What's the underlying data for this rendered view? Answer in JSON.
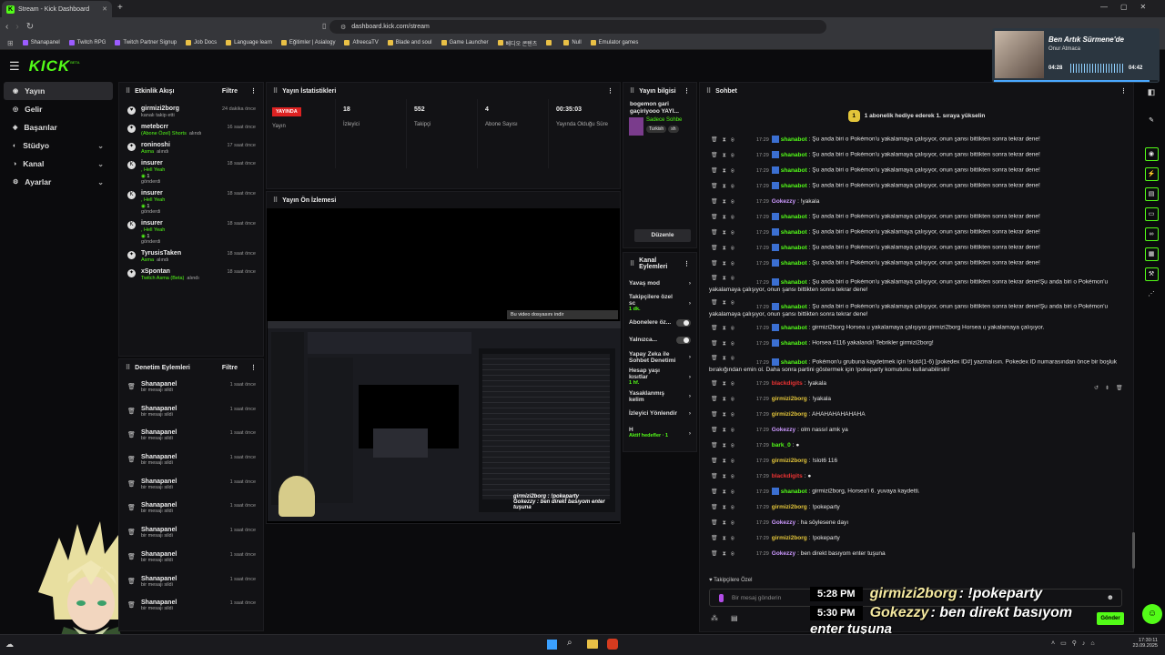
{
  "browser": {
    "tab_title": "Stream - Kick Dashboard",
    "url": "dashboard.kick.com/stream",
    "bookmarks": [
      "Shanapanel",
      "Twitch RPG",
      "Twitch Partner Signup",
      "Job Docs",
      "Language learn",
      "Eğitimler | Asialogy",
      "AfreecaTV",
      "Blade and soul",
      "Game Launcher",
      "베디오 콘텐츠",
      "",
      "Null",
      "Emulator games"
    ]
  },
  "app": {
    "logo": "KICK",
    "logo_sup": "BETA"
  },
  "nav": [
    {
      "label": "Yayın",
      "active": true
    },
    {
      "label": "Gelir"
    },
    {
      "label": "Başarılar"
    },
    {
      "label": "Stüdyo",
      "chev": true
    },
    {
      "label": "Kanal",
      "chev": true
    },
    {
      "label": "Ayarlar",
      "chev": true
    }
  ],
  "activity": {
    "title": "Etkinlik Akışı",
    "filter": "Filtre",
    "rows": [
      {
        "name": "girmizi2borg",
        "sub": "kanalı takip etti",
        "time": "24 dakika önce",
        "sub_gray": true
      },
      {
        "name": "metebcrr",
        "sub": "(Abone Özel) Shorts",
        "sub2": "alındı",
        "time": "16 saat önce"
      },
      {
        "name": "roninoshi",
        "sub": "Asma",
        "sub2": "alındı",
        "time": "17 saat önce"
      },
      {
        "name": "insurer",
        "sub": ", Hell Yeah",
        "sub3": "1",
        "sub4": "gönderdi",
        "time": "18 saat önce"
      },
      {
        "name": "insurer",
        "sub": ", Hell Yeah",
        "sub3": "1",
        "sub4": "gönderdi",
        "time": "18 saat önce"
      },
      {
        "name": "insurer",
        "sub": ", Hell Yeah",
        "sub3": "1",
        "sub4": "gönderdi",
        "time": "18 saat önce"
      },
      {
        "name": "TyrusisTaken",
        "sub": "Asma",
        "sub2": "alındı",
        "time": "18 saat önce"
      },
      {
        "name": "xSpontan",
        "sub": "Twitch Asma (Beta)",
        "sub2": "alındı",
        "time": "18 saat önce"
      }
    ]
  },
  "moderation": {
    "title": "Denetim Eylemleri",
    "filter": "Filtre",
    "rows": [
      {
        "name": "Shanapanel",
        "sub": "bir mesajı sildi",
        "time": "1 saat önce"
      },
      {
        "name": "Shanapanel",
        "sub": "bir mesajı sildi",
        "time": "1 saat önce"
      },
      {
        "name": "Shanapanel",
        "sub": "bir mesajı sildi",
        "time": "1 saat önce"
      },
      {
        "name": "Shanapanel",
        "sub": "bir mesajı sildi",
        "time": "1 saat önce"
      },
      {
        "name": "Shanapanel",
        "sub": "bir mesajı sildi",
        "time": "1 saat önce"
      },
      {
        "name": "Shanapanel",
        "sub": "bir mesajı sildi",
        "time": "1 saat önce"
      },
      {
        "name": "Shanapanel",
        "sub": "bir mesajı sildi",
        "time": "1 saat önce"
      },
      {
        "name": "Shanapanel",
        "sub": "bir mesajı sildi",
        "time": "1 saat önce"
      },
      {
        "name": "Shanapanel",
        "sub": "bir mesajı sildi",
        "time": "1 saat önce"
      },
      {
        "name": "Shanapanel",
        "sub": "bir mesajı sildi",
        "time": "1 saat önce"
      }
    ]
  },
  "stats": {
    "title": "Yayın İstatistikleri",
    "live": "YAYINDA",
    "live_label": "Yayın",
    "items": [
      {
        "value": "18",
        "label": "İzleyici"
      },
      {
        "value": "552",
        "label": "Takipçi"
      },
      {
        "value": "4",
        "label": "Abone Sayısı"
      },
      {
        "value": "00:35:03",
        "label": "Yayında Olduğu Süre"
      }
    ]
  },
  "preview": {
    "title": "Yayın Ön İzlemesi",
    "download_banner": "Bu video dosyasını indir",
    "overlay1": "girmizi2borg : !pokeparty",
    "overlay2": "Gokezzy : ben direkt basıyom enter tuşuna"
  },
  "streaminfo": {
    "title": "Yayın bilgisi",
    "stream_title": "bogemon gari gaçiriyooo YAYI...",
    "tag1": "Sadece Sohbe",
    "lang": "Turkish",
    "tag2": "sh",
    "edit": "Düzenle"
  },
  "channel_actions": {
    "title": "Kanal Eylemleri",
    "items": [
      {
        "label": "Yavaş mod",
        "right": "›"
      },
      {
        "label": "Takipçilere özel sc",
        "sub": "1 dk.",
        "right": "›"
      },
      {
        "label": "Abonelere öz...",
        "toggle": true
      },
      {
        "label": "Yalnızca...",
        "toggle": true
      },
      {
        "label": "Yapay Zeka ile Sohbet Denetimi",
        "right": "›"
      },
      {
        "label": "Hesap yaşı kısıtlar",
        "sub": "1 hf.",
        "right": "›"
      },
      {
        "label": "Yasaklanmış kelim",
        "right": "›"
      },
      {
        "label": "İzleyici Yönlendir",
        "right": "›"
      },
      {
        "label": "H",
        "sub": "Aktif hedefler · 1",
        "right": "›"
      }
    ]
  },
  "chat": {
    "title": "Sohbet",
    "pinned": "1 abonelik hediye ederek 1. sıraya yükselin",
    "followers_only": "Takipçilere Özel",
    "placeholder": "Bir mesaj gönderin",
    "send": "Gönder",
    "messages": [
      {
        "t": "17:29",
        "u": "shanabot",
        "c": "#53fc18",
        "bot": true,
        "m": ": Şu anda biri o Pokémon'u yakalamaya çalışıyor, onun şansı bittikten sonra tekrar dene!"
      },
      {
        "t": "17:29",
        "u": "shanabot",
        "c": "#53fc18",
        "bot": true,
        "m": ": Şu anda biri o Pokémon'u yakalamaya çalışıyor, onun şansı bittikten sonra tekrar dene!"
      },
      {
        "t": "17:29",
        "u": "shanabot",
        "c": "#53fc18",
        "bot": true,
        "m": ": Şu anda biri o Pokémon'u yakalamaya çalışıyor, onun şansı bittikten sonra tekrar dene!"
      },
      {
        "t": "17:29",
        "u": "shanabot",
        "c": "#53fc18",
        "bot": true,
        "m": ": Şu anda biri o Pokémon'u yakalamaya çalışıyor, onun şansı bittikten sonra tekrar dene!"
      },
      {
        "t": "17:29",
        "u": "Gokezzy",
        "c": "#c9f",
        "m": ": !yakala"
      },
      {
        "t": "17:29",
        "u": "shanabot",
        "c": "#53fc18",
        "bot": true,
        "m": ": Şu anda biri o Pokémon'u yakalamaya çalışıyor, onun şansı bittikten sonra tekrar dene!"
      },
      {
        "t": "17:29",
        "u": "shanabot",
        "c": "#53fc18",
        "bot": true,
        "m": ": Şu anda biri o Pokémon'u yakalamaya çalışıyor, onun şansı bittikten sonra tekrar dene!"
      },
      {
        "t": "17:29",
        "u": "shanabot",
        "c": "#53fc18",
        "bot": true,
        "m": ": Şu anda biri o Pokémon'u yakalamaya çalışıyor, onun şansı bittikten sonra tekrar dene!"
      },
      {
        "t": "17:29",
        "u": "shanabot",
        "c": "#53fc18",
        "bot": true,
        "m": ": Şu anda biri o Pokémon'u yakalamaya çalışıyor, onun şansı bittikten sonra tekrar dene!"
      },
      {
        "t": "17:29",
        "u": "shanabot",
        "c": "#53fc18",
        "bot": true,
        "m": ": Şu anda biri o Pokémon'u yakalamaya çalışıyor, onun şansı bittikten sonra tekrar dene!Şu anda biri o Pokémon'u yakalamaya çalışıyor, onun şansı bittikten sonra tekrar dene!",
        "two": true
      },
      {
        "t": "17:29",
        "u": "shanabot",
        "c": "#53fc18",
        "bot": true,
        "m": ": Şu anda biri o Pokémon'u yakalamaya çalışıyor, onun şansı bittikten sonra tekrar dene!Şu anda biri o Pokémon'u yakalamaya çalışıyor, onun şansı bittikten sonra tekrar dene!",
        "two": true
      },
      {
        "t": "17:29",
        "u": "shanabot",
        "c": "#53fc18",
        "bot": true,
        "m": ": girmizi2borg Horsea u yakalamaya çalışıyor.girmizi2borg Horsea u yakalamaya çalışıyor."
      },
      {
        "t": "17:29",
        "u": "shanabot",
        "c": "#53fc18",
        "bot": true,
        "m": ": Horsea #116 yakalandı! Tebrikler girmizi2borg!"
      },
      {
        "t": "17:29",
        "u": "shanabot",
        "c": "#53fc18",
        "bot": true,
        "m": ": Pokémon'u grubuna kaydetmek için !slot#(1-6) [pokedex ID#] yazmalısın. Pokedex ID numarasından önce bir boşluk bırakığından emin ol. Daha sonra partini göstermek için !pokeparty komutunu kullanabilirsin!",
        "two": true
      },
      {
        "t": "17:29",
        "u": "blackdigits",
        "c": "#e33",
        "m": ": !yakala"
      },
      {
        "t": "17:29",
        "u": "girmizi2borg",
        "c": "#e3c53a",
        "m": ": !yakala"
      },
      {
        "t": "17:29",
        "u": "girmizi2borg",
        "c": "#e3c53a",
        "m": ": AHAHAHAHAHAHA"
      },
      {
        "t": "17:29",
        "u": "Gokezzy",
        "c": "#c9f",
        "m": ": olm nassıl amk ya"
      },
      {
        "t": "17:29",
        "u": "bark_0",
        "c": "#53fc18",
        "m": ": ●"
      },
      {
        "t": "17:29",
        "u": "girmizi2borg",
        "c": "#e3c53a",
        "m": ": !slot6 116"
      },
      {
        "t": "17:29",
        "u": "blackdigits",
        "c": "#e33",
        "m": ": ●"
      },
      {
        "t": "17:29",
        "u": "shanabot",
        "c": "#53fc18",
        "bot": true,
        "m": ": girmizi2borg, Horsea'i 6. yuvaya kaydetti."
      },
      {
        "t": "17:29",
        "u": "girmizi2borg",
        "c": "#e3c53a",
        "m": ": !pokeparty"
      },
      {
        "t": "17:29",
        "u": "Gokezzy",
        "c": "#c9f",
        "m": ": ha söylesene dayı"
      },
      {
        "t": "17:29",
        "u": "girmizi2borg",
        "c": "#e3c53a",
        "m": ": !pokeparty"
      },
      {
        "t": "17:29",
        "u": "Gokezzy",
        "c": "#c9f",
        "m": ": ben direkt basıyom enter tuşuna"
      }
    ]
  },
  "captions": [
    {
      "time": "5:28 PM",
      "user": "girmizi2borg",
      "text": ": !pokeparty"
    },
    {
      "time": "5:30 PM",
      "user": "Gokezzy",
      "text": ": ben direkt basıyom",
      "cont": "enter tuşuna"
    }
  ],
  "music": {
    "title": "Ben Artık Sürmene'de",
    "artist": "Onur Atmaca",
    "elapsed": "04:28",
    "total": "04:42",
    "progress": 0.95
  },
  "clock": {
    "time": "17:30:11",
    "date": "23.09.2025"
  }
}
